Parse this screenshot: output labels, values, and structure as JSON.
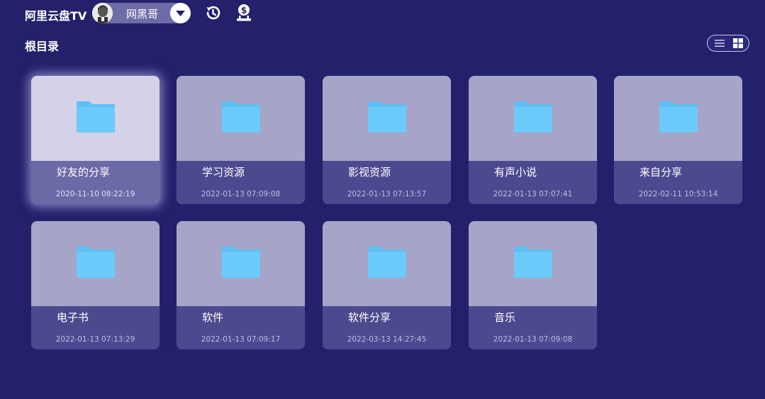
{
  "header": {
    "app_title": "阿里云盘TV",
    "user_name": "网黑哥",
    "icons": [
      "avatar",
      "chevron-down-icon",
      "history-icon",
      "coin-icon"
    ]
  },
  "breadcrumb": "根目录",
  "view_toggle": {
    "icons": [
      "list-view-icon",
      "grid-view-icon"
    ],
    "active": "grid"
  },
  "colors": {
    "background": "#23216b",
    "card": "#a6a5c8",
    "card_focused": "#d3d2e8",
    "card_info": "#4c4a8f",
    "folder": "#63c5f8"
  },
  "folders": [
    {
      "name": "好友的分享",
      "date": "2020-11-10 08:22:19",
      "focused": true
    },
    {
      "name": "学习资源",
      "date": "2022-01-13 07:09:08"
    },
    {
      "name": "影视资源",
      "date": "2022-01-13 07:13:57"
    },
    {
      "name": "有声小说",
      "date": "2022-01-13 07:07:41"
    },
    {
      "name": "来自分享",
      "date": "2022-02-11 10:53:14"
    },
    {
      "name": "电子书",
      "date": "2022-01-13 07:13:29"
    },
    {
      "name": "软件",
      "date": "2022-01-13 07:09:17"
    },
    {
      "name": "软件分享",
      "date": "2022-03-13 14:27:45"
    },
    {
      "name": "音乐",
      "date": "2022-01-13 07:09:08"
    }
  ]
}
